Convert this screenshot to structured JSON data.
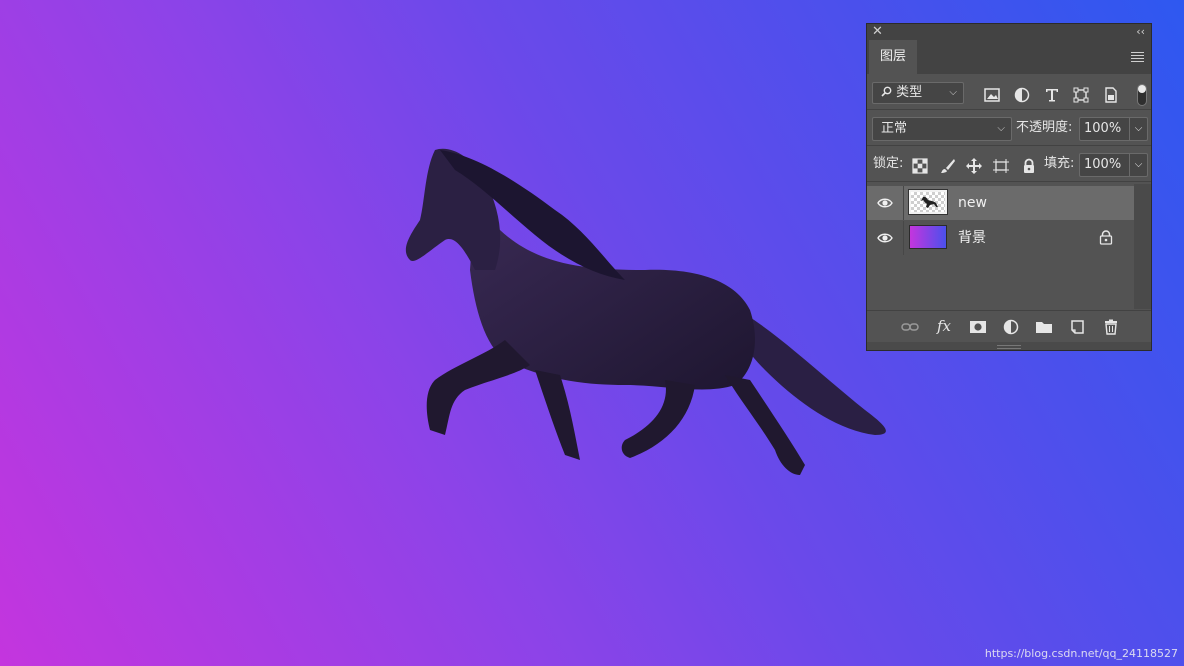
{
  "panel": {
    "close_glyph": "✕",
    "collapse_glyph": "‹‹",
    "tab_label": "图层",
    "filter": {
      "value": "类型",
      "icons": [
        "image-filter-icon",
        "adjustment-filter-icon",
        "type-filter-icon",
        "shape-filter-icon",
        "smart-object-filter-icon"
      ],
      "toggle_on": true
    },
    "blend_mode": {
      "value": "正常"
    },
    "opacity": {
      "label": "不透明度:",
      "value": "100%"
    },
    "lock": {
      "label": "锁定:",
      "icons": [
        "lock-transparent-pixels-icon",
        "lock-image-pixels-icon",
        "lock-position-icon",
        "lock-artboard-icon",
        "lock-all-icon"
      ]
    },
    "fill": {
      "label": "填充:",
      "value": "100%"
    },
    "layers": [
      {
        "name": "new",
        "visible": true,
        "selected": true,
        "locked": false,
        "thumbnail": "transparent-horse"
      },
      {
        "name": "背景",
        "visible": true,
        "selected": false,
        "locked": true,
        "thumbnail": "gradient"
      }
    ],
    "bottom_actions": {
      "fx_label": "fx"
    }
  },
  "canvas": {
    "background_colors": [
      "#c435de",
      "#2e58f0"
    ]
  },
  "watermark": "https://blog.csdn.net/qq_24118527"
}
